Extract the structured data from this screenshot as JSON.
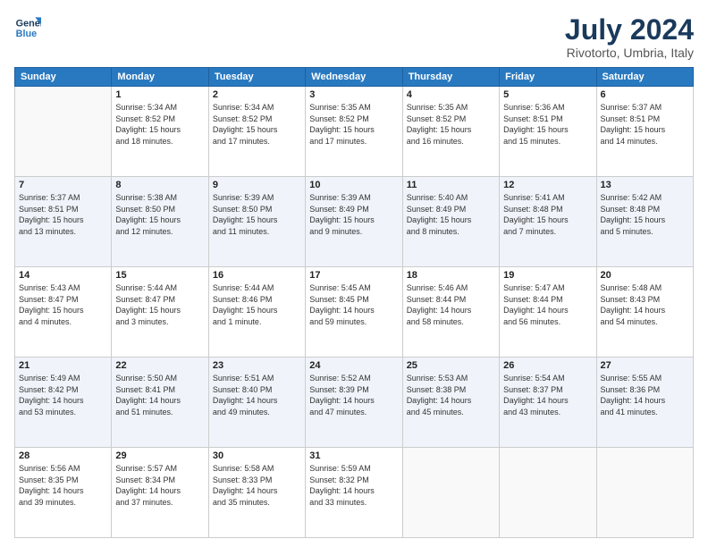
{
  "logo": {
    "line1": "General",
    "line2": "Blue"
  },
  "title": "July 2024",
  "location": "Rivotorto, Umbria, Italy",
  "weekdays": [
    "Sunday",
    "Monday",
    "Tuesday",
    "Wednesday",
    "Thursday",
    "Friday",
    "Saturday"
  ],
  "weeks": [
    [
      {
        "day": "",
        "info": ""
      },
      {
        "day": "1",
        "info": "Sunrise: 5:34 AM\nSunset: 8:52 PM\nDaylight: 15 hours\nand 18 minutes."
      },
      {
        "day": "2",
        "info": "Sunrise: 5:34 AM\nSunset: 8:52 PM\nDaylight: 15 hours\nand 17 minutes."
      },
      {
        "day": "3",
        "info": "Sunrise: 5:35 AM\nSunset: 8:52 PM\nDaylight: 15 hours\nand 17 minutes."
      },
      {
        "day": "4",
        "info": "Sunrise: 5:35 AM\nSunset: 8:52 PM\nDaylight: 15 hours\nand 16 minutes."
      },
      {
        "day": "5",
        "info": "Sunrise: 5:36 AM\nSunset: 8:51 PM\nDaylight: 15 hours\nand 15 minutes."
      },
      {
        "day": "6",
        "info": "Sunrise: 5:37 AM\nSunset: 8:51 PM\nDaylight: 15 hours\nand 14 minutes."
      }
    ],
    [
      {
        "day": "7",
        "info": "Sunrise: 5:37 AM\nSunset: 8:51 PM\nDaylight: 15 hours\nand 13 minutes."
      },
      {
        "day": "8",
        "info": "Sunrise: 5:38 AM\nSunset: 8:50 PM\nDaylight: 15 hours\nand 12 minutes."
      },
      {
        "day": "9",
        "info": "Sunrise: 5:39 AM\nSunset: 8:50 PM\nDaylight: 15 hours\nand 11 minutes."
      },
      {
        "day": "10",
        "info": "Sunrise: 5:39 AM\nSunset: 8:49 PM\nDaylight: 15 hours\nand 9 minutes."
      },
      {
        "day": "11",
        "info": "Sunrise: 5:40 AM\nSunset: 8:49 PM\nDaylight: 15 hours\nand 8 minutes."
      },
      {
        "day": "12",
        "info": "Sunrise: 5:41 AM\nSunset: 8:48 PM\nDaylight: 15 hours\nand 7 minutes."
      },
      {
        "day": "13",
        "info": "Sunrise: 5:42 AM\nSunset: 8:48 PM\nDaylight: 15 hours\nand 5 minutes."
      }
    ],
    [
      {
        "day": "14",
        "info": "Sunrise: 5:43 AM\nSunset: 8:47 PM\nDaylight: 15 hours\nand 4 minutes."
      },
      {
        "day": "15",
        "info": "Sunrise: 5:44 AM\nSunset: 8:47 PM\nDaylight: 15 hours\nand 3 minutes."
      },
      {
        "day": "16",
        "info": "Sunrise: 5:44 AM\nSunset: 8:46 PM\nDaylight: 15 hours\nand 1 minute."
      },
      {
        "day": "17",
        "info": "Sunrise: 5:45 AM\nSunset: 8:45 PM\nDaylight: 14 hours\nand 59 minutes."
      },
      {
        "day": "18",
        "info": "Sunrise: 5:46 AM\nSunset: 8:44 PM\nDaylight: 14 hours\nand 58 minutes."
      },
      {
        "day": "19",
        "info": "Sunrise: 5:47 AM\nSunset: 8:44 PM\nDaylight: 14 hours\nand 56 minutes."
      },
      {
        "day": "20",
        "info": "Sunrise: 5:48 AM\nSunset: 8:43 PM\nDaylight: 14 hours\nand 54 minutes."
      }
    ],
    [
      {
        "day": "21",
        "info": "Sunrise: 5:49 AM\nSunset: 8:42 PM\nDaylight: 14 hours\nand 53 minutes."
      },
      {
        "day": "22",
        "info": "Sunrise: 5:50 AM\nSunset: 8:41 PM\nDaylight: 14 hours\nand 51 minutes."
      },
      {
        "day": "23",
        "info": "Sunrise: 5:51 AM\nSunset: 8:40 PM\nDaylight: 14 hours\nand 49 minutes."
      },
      {
        "day": "24",
        "info": "Sunrise: 5:52 AM\nSunset: 8:39 PM\nDaylight: 14 hours\nand 47 minutes."
      },
      {
        "day": "25",
        "info": "Sunrise: 5:53 AM\nSunset: 8:38 PM\nDaylight: 14 hours\nand 45 minutes."
      },
      {
        "day": "26",
        "info": "Sunrise: 5:54 AM\nSunset: 8:37 PM\nDaylight: 14 hours\nand 43 minutes."
      },
      {
        "day": "27",
        "info": "Sunrise: 5:55 AM\nSunset: 8:36 PM\nDaylight: 14 hours\nand 41 minutes."
      }
    ],
    [
      {
        "day": "28",
        "info": "Sunrise: 5:56 AM\nSunset: 8:35 PM\nDaylight: 14 hours\nand 39 minutes."
      },
      {
        "day": "29",
        "info": "Sunrise: 5:57 AM\nSunset: 8:34 PM\nDaylight: 14 hours\nand 37 minutes."
      },
      {
        "day": "30",
        "info": "Sunrise: 5:58 AM\nSunset: 8:33 PM\nDaylight: 14 hours\nand 35 minutes."
      },
      {
        "day": "31",
        "info": "Sunrise: 5:59 AM\nSunset: 8:32 PM\nDaylight: 14 hours\nand 33 minutes."
      },
      {
        "day": "",
        "info": ""
      },
      {
        "day": "",
        "info": ""
      },
      {
        "day": "",
        "info": ""
      }
    ]
  ]
}
